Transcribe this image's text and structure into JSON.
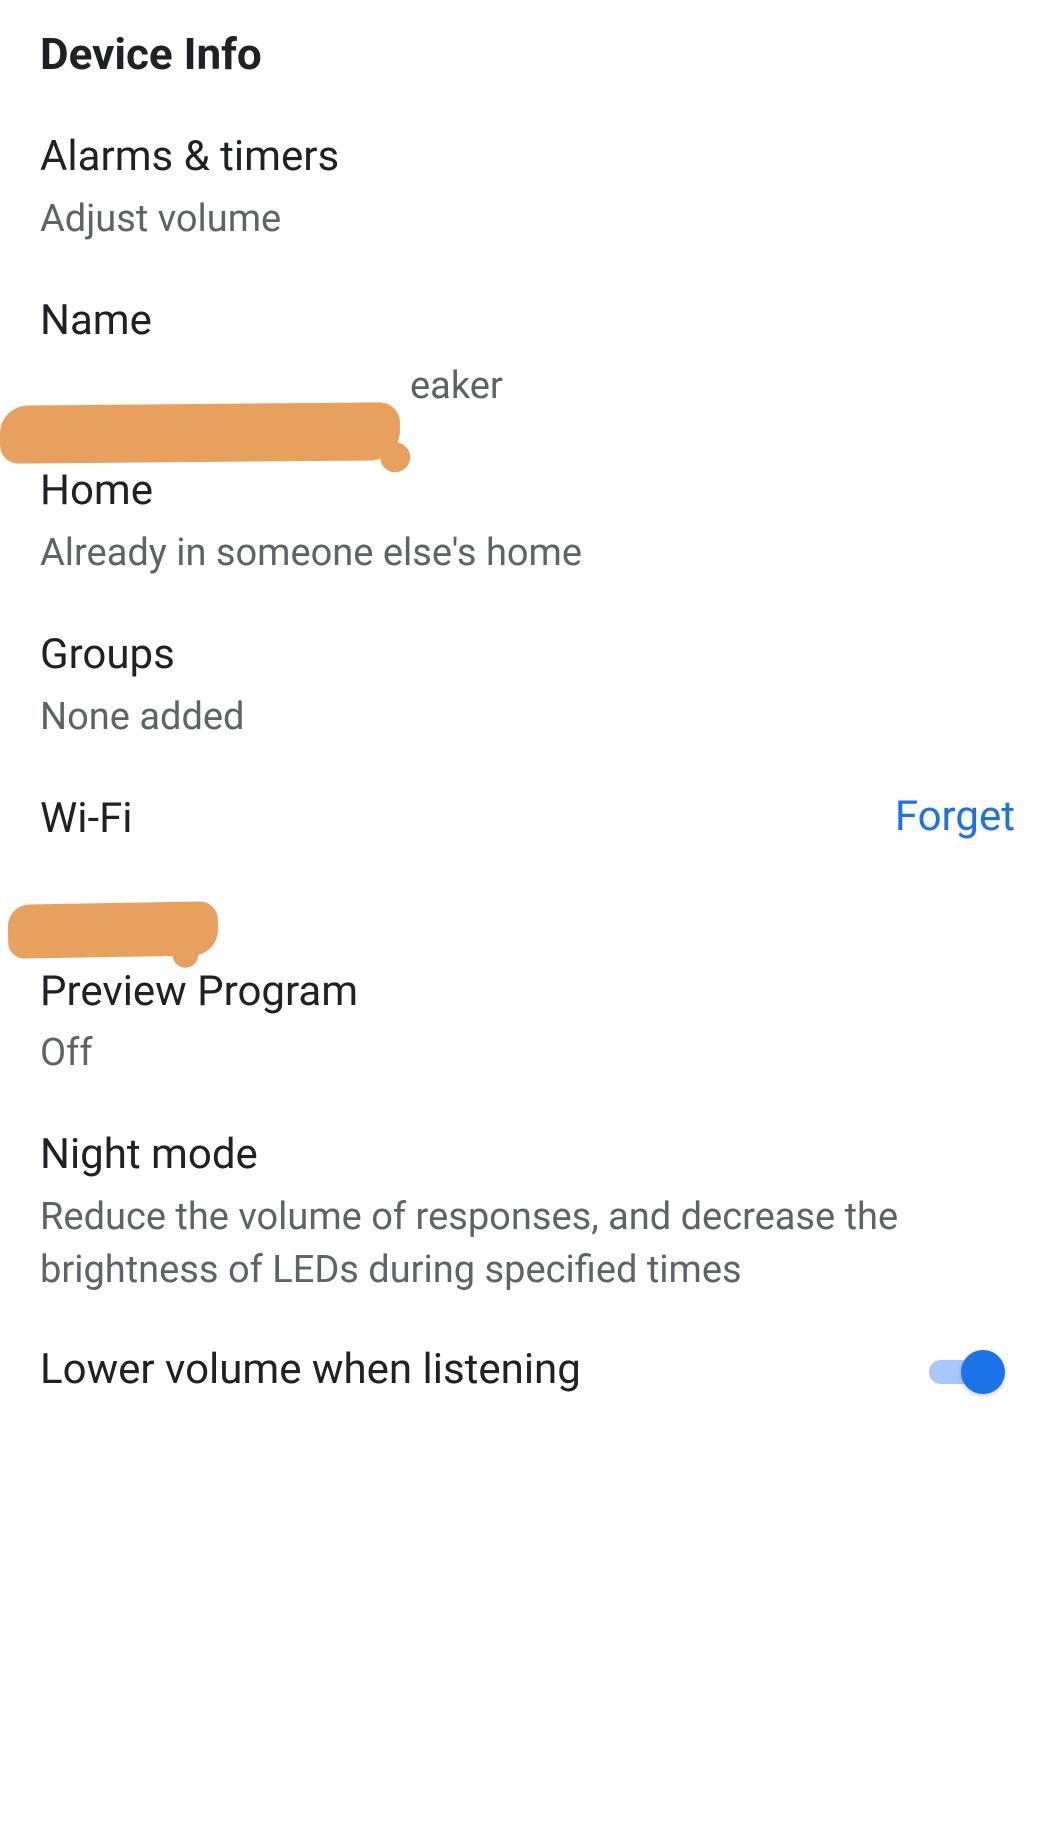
{
  "header": {
    "title": "Device Info"
  },
  "settings": {
    "alarms": {
      "title": "Alarms & timers",
      "subtitle": "Adjust volume"
    },
    "name": {
      "title": "Name",
      "visible_suffix": "eaker"
    },
    "home": {
      "title": "Home",
      "subtitle": "Already in someone else's home"
    },
    "groups": {
      "title": "Groups",
      "subtitle": "None added"
    },
    "wifi": {
      "title": "Wi-Fi",
      "action": "Forget"
    },
    "preview": {
      "title": "Preview Program",
      "subtitle": "Off"
    },
    "nightmode": {
      "title": "Night mode",
      "subtitle": "Reduce the volume of responses, and decrease the brightness of LEDs during specified times"
    },
    "lowervolume": {
      "title": "Lower volume when listening",
      "enabled": true
    }
  }
}
